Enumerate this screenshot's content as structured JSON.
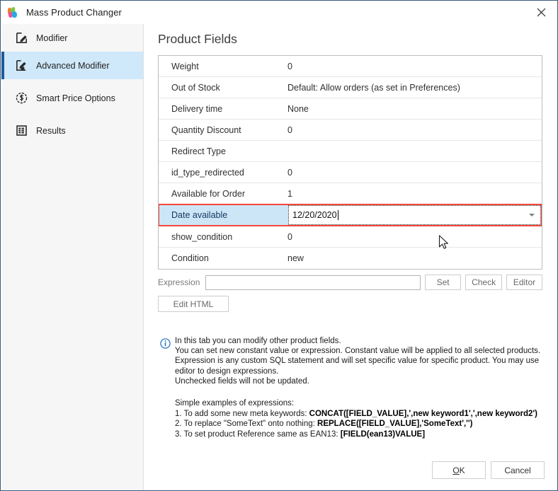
{
  "window": {
    "title": "Mass Product Changer",
    "app_icon": "leaf-logo-icon",
    "close_label": "✕"
  },
  "sidebar": {
    "items": [
      {
        "label": "Modifier",
        "icon": "pencil-edit-icon",
        "active": false
      },
      {
        "label": "Advanced Modifier",
        "icon": "advanced-edit-icon",
        "active": true
      },
      {
        "label": "Smart Price Options",
        "icon": "dollar-circle-icon",
        "active": false
      },
      {
        "label": "Results",
        "icon": "grid-table-icon",
        "active": false
      }
    ]
  },
  "main": {
    "page_title": "Product Fields",
    "fields": [
      {
        "name": "Weight",
        "value": "0"
      },
      {
        "name": "Out of Stock",
        "value": "Default: Allow orders (as set in Preferences)"
      },
      {
        "name": "Delivery time",
        "value": "None"
      },
      {
        "name": "Quantity Discount",
        "value": "0"
      },
      {
        "name": "Redirect Type",
        "value": ""
      },
      {
        "name": "id_type_redirected",
        "value": "0"
      },
      {
        "name": "Available for Order",
        "value": "1"
      },
      {
        "name": "Date available",
        "value": "12/20/2020",
        "editing": true
      },
      {
        "name": "show_condition",
        "value": "0"
      },
      {
        "name": "Condition",
        "value": "new"
      }
    ],
    "expression": {
      "label": "Expression",
      "value": "",
      "placeholder": "",
      "set_label": "Set",
      "check_label": "Check",
      "editor_label": "Editor",
      "edit_html_label": "Edit HTML"
    },
    "info": {
      "icon": "info-circle-icon",
      "lines": [
        "In this tab you can modify other product fields.",
        "You can set new constant value or expression. Constant value will be applied to all selected products.",
        "Expression is any custom SQL statement and will set specific value for specific product. You may use editor to design expressions.",
        "Unchecked fields will not be updated."
      ],
      "examples_title": "Simple examples of expressions:",
      "examples": [
        {
          "prefix": "1. To add some new meta keywords: ",
          "code": "CONCAT([FIELD_VALUE],',new keyword1',',new keyword2')"
        },
        {
          "prefix": "2. To replace \"SomeText\" onto nothing: ",
          "code": "REPLACE([FIELD_VALUE],'SomeText','')"
        },
        {
          "prefix": "3. To set product Reference same as EAN13: ",
          "code": "[FIELD(ean13)VALUE]"
        }
      ]
    }
  },
  "footer": {
    "ok_accel": "O",
    "ok_rest": "K",
    "cancel_label": "Cancel"
  },
  "colors": {
    "accent_selected": "#1b5a99",
    "sidebar_selected_bg": "#cfe8fa",
    "highlight_border": "#f4473b",
    "field_label_bg": "#cde6f7",
    "info_blue": "#1f6fc4"
  }
}
